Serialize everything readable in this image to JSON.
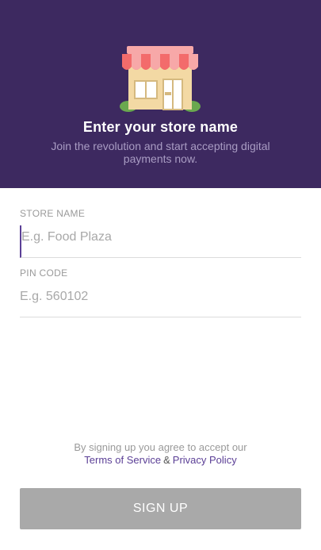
{
  "header": {
    "title": "Enter your store name",
    "subtitle": "Join the revolution and start accepting digital payments now.",
    "illustration": "store-front-icon",
    "background_color": "#3d2960"
  },
  "form": {
    "store_name": {
      "label": "STORE NAME",
      "placeholder": "E.g. Food Plaza",
      "value": ""
    },
    "pin_code": {
      "label": "PIN CODE",
      "placeholder": "E.g. 560102",
      "value": ""
    }
  },
  "terms": {
    "text": "By signing up you agree to accept our",
    "terms_link": "Terms of Service",
    "separator": "&",
    "privacy_link": "Privacy Policy",
    "link_color": "#5b3f96"
  },
  "actions": {
    "signup_label": "SIGN UP",
    "button_color": "#a9a9a9"
  }
}
